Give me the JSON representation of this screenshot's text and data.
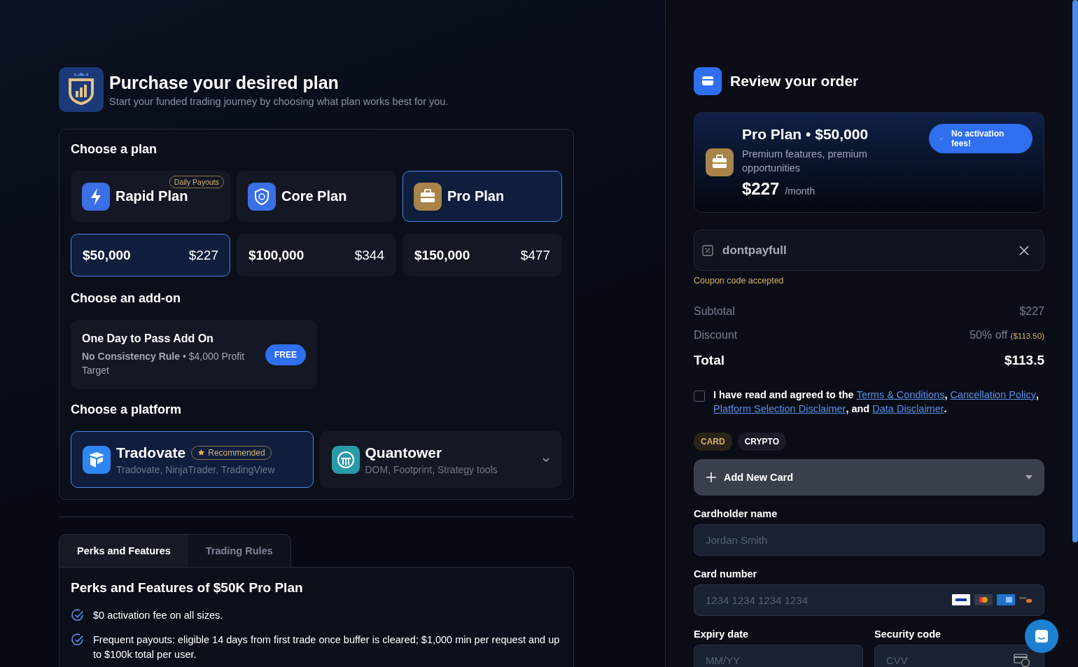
{
  "header": {
    "title": "Purchase your desired plan",
    "subtitle": "Start your funded trading journey by choosing what plan works best for you."
  },
  "plan_section": {
    "heading": "Choose a plan",
    "plans": [
      {
        "name": "Rapid Plan",
        "badge": "Daily Payouts",
        "selected": false
      },
      {
        "name": "Core Plan",
        "selected": false
      },
      {
        "name": "Pro Plan",
        "selected": true
      }
    ],
    "sizes": [
      {
        "size": "$50,000",
        "price": "$227",
        "selected": true
      },
      {
        "size": "$100,000",
        "price": "$344",
        "selected": false
      },
      {
        "size": "$150,000",
        "price": "$477",
        "selected": false
      }
    ]
  },
  "addon_section": {
    "heading": "Choose an add-on",
    "addon": {
      "title": "One Day to Pass Add On",
      "description": "**No Consistency Rule** • $4,000 Profit Target",
      "price": "FREE"
    }
  },
  "platform_section": {
    "heading": "Choose a platform",
    "platforms": [
      {
        "name": "Tradovate",
        "badge": "Recommended",
        "description": "Tradovate, NinjaTrader, TradingView",
        "selected": true,
        "expandable": false
      },
      {
        "name": "Quantower",
        "description": "DOM, Footprint, Strategy tools",
        "selected": false,
        "expandable": true
      }
    ]
  },
  "tabs": [
    {
      "label": "Perks and Features",
      "selected": true
    },
    {
      "label": "Trading Rules",
      "selected": false
    }
  ],
  "perks": {
    "title": "Perks and Features of $50K Pro Plan",
    "items": [
      "$0 activation fee on all sizes.",
      "Frequent payouts: eligible 14 days from first trade once buffer is cleared; $1,000 min per request and up to $100k total per user."
    ]
  },
  "order": {
    "title": "Review your order",
    "summary": {
      "title": "Pro Plan • $50,000",
      "description": "Premium features, premium opportunities",
      "price": "$227",
      "period": "/month",
      "badge": "No activation fees!"
    },
    "coupon": {
      "value": "dontpayfull",
      "status": "Coupon code accepted"
    },
    "lines": [
      {
        "label": "Subtotal",
        "value": "$227"
      },
      {
        "label": "Discount",
        "value": "50% off",
        "note": "($113.50)"
      }
    ],
    "total": {
      "label": "Total",
      "value": "$113.5"
    },
    "agreement": {
      "checked": false,
      "parts": [
        {
          "text": "I have read and agreed to the ",
          "link": false
        },
        {
          "text": "Terms & Conditions",
          "link": true
        },
        {
          "text": ", ",
          "link": false
        },
        {
          "text": "Cancellation Policy",
          "link": true
        },
        {
          "text": ", ",
          "link": false
        },
        {
          "text": "Platform Selection Disclaimer",
          "link": true
        },
        {
          "text": ", and ",
          "link": false
        },
        {
          "text": "Data Disclaimer",
          "link": true
        },
        {
          "text": ".",
          "link": false
        }
      ]
    },
    "payment_tabs": [
      {
        "label": "CARD",
        "selected": true
      },
      {
        "label": "CRYPTO",
        "selected": false
      }
    ],
    "card_select": {
      "label": "Add New Card"
    },
    "fields": [
      {
        "label": "Cardholder name",
        "placeholder": "Jordan Smith",
        "kind": "full"
      },
      {
        "label": "Card number",
        "placeholder": "1234 1234 1234 1234",
        "kind": "card"
      },
      {
        "label": "Expiry date",
        "placeholder": "MM/YY",
        "kind": "half"
      },
      {
        "label": "Security code",
        "placeholder": "CVV",
        "kind": "cvv"
      }
    ]
  }
}
